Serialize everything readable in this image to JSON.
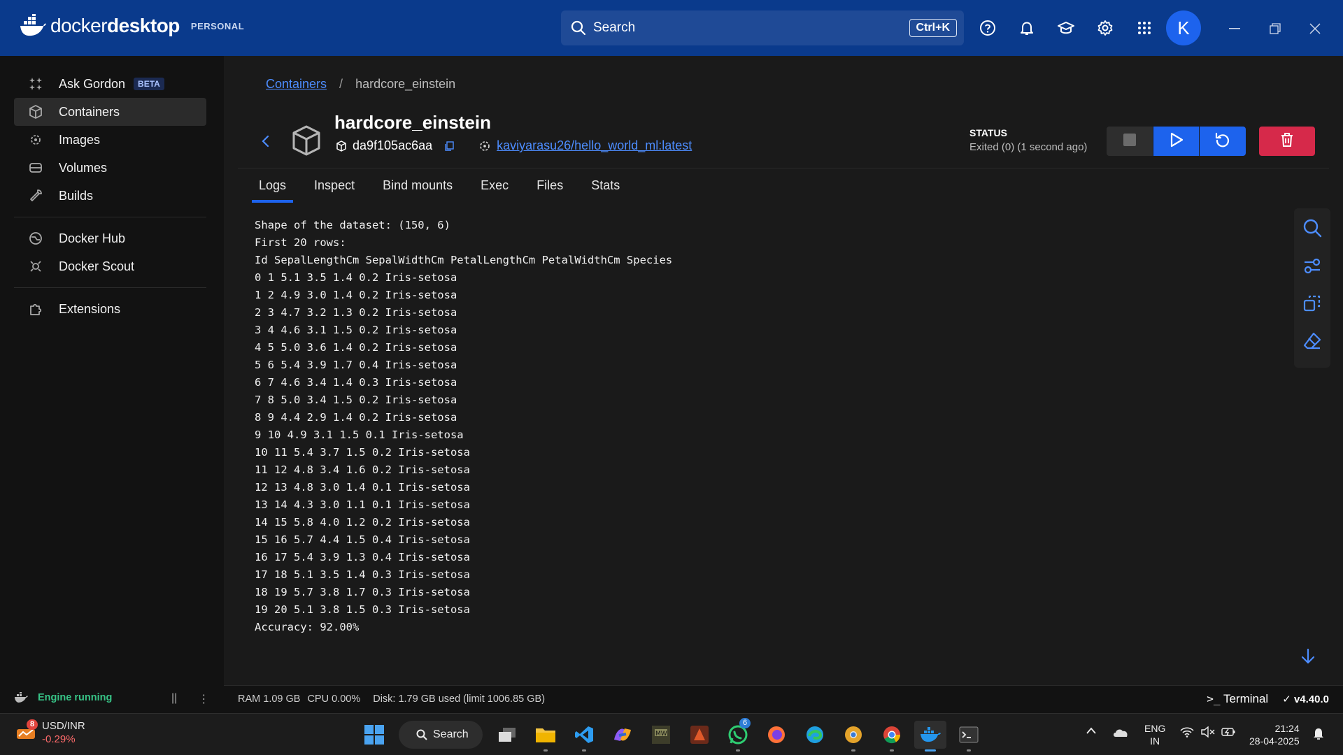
{
  "app": {
    "logo_text_light": "docker",
    "logo_text_bold": "desktop",
    "plan_badge": "PERSONAL",
    "search_placeholder": "Search",
    "search_shortcut": "Ctrl+K",
    "avatar_initial": "K",
    "accent_color": "#1d63ed",
    "topbar_color": "#0a3a8c"
  },
  "sidebar": {
    "items": [
      {
        "label": "Ask Gordon",
        "icon": "sparkle-icon",
        "badge": "BETA"
      },
      {
        "label": "Containers",
        "icon": "container-icon",
        "active": true
      },
      {
        "label": "Images",
        "icon": "image-icon"
      },
      {
        "label": "Volumes",
        "icon": "volume-icon"
      },
      {
        "label": "Builds",
        "icon": "wrench-icon"
      },
      {
        "label": "Docker Hub",
        "icon": "hub-icon"
      },
      {
        "label": "Docker Scout",
        "icon": "scout-icon"
      },
      {
        "label": "Extensions",
        "icon": "puzzle-icon"
      }
    ]
  },
  "breadcrumb": {
    "parent": "Containers",
    "separator": "/",
    "current": "hardcore_einstein"
  },
  "container": {
    "name": "hardcore_einstein",
    "id": "da9f105ac6aa",
    "image": "kaviyarasu26/hello_world_ml:latest",
    "status_label": "STATUS",
    "status_value": "Exited (0) (1 second ago)"
  },
  "tabs": [
    "Logs",
    "Inspect",
    "Bind mounts",
    "Exec",
    "Files",
    "Stats"
  ],
  "logs": [
    "Shape of the dataset: (150, 6)",
    "First 20 rows:",
    "Id SepalLengthCm SepalWidthCm PetalLengthCm PetalWidthCm Species",
    "0 1 5.1 3.5 1.4 0.2 Iris-setosa",
    "1 2 4.9 3.0 1.4 0.2 Iris-setosa",
    "2 3 4.7 3.2 1.3 0.2 Iris-setosa",
    "3 4 4.6 3.1 1.5 0.2 Iris-setosa",
    "4 5 5.0 3.6 1.4 0.2 Iris-setosa",
    "5 6 5.4 3.9 1.7 0.4 Iris-setosa",
    "6 7 4.6 3.4 1.4 0.3 Iris-setosa",
    "7 8 5.0 3.4 1.5 0.2 Iris-setosa",
    "8 9 4.4 2.9 1.4 0.2 Iris-setosa",
    "9 10 4.9 3.1 1.5 0.1 Iris-setosa",
    "10 11 5.4 3.7 1.5 0.2 Iris-setosa",
    "11 12 4.8 3.4 1.6 0.2 Iris-setosa",
    "12 13 4.8 3.0 1.4 0.1 Iris-setosa",
    "13 14 4.3 3.0 1.1 0.1 Iris-setosa",
    "14 15 5.8 4.0 1.2 0.2 Iris-setosa",
    "15 16 5.7 4.4 1.5 0.4 Iris-setosa",
    "16 17 5.4 3.9 1.3 0.4 Iris-setosa",
    "17 18 5.1 3.5 1.4 0.3 Iris-setosa",
    "18 19 5.7 3.8 1.7 0.3 Iris-setosa",
    "19 20 5.1 3.8 1.5 0.3 Iris-setosa",
    "Accuracy: 92.00%"
  ],
  "footer": {
    "engine_status": "Engine running",
    "ram": "RAM 1.09 GB",
    "cpu": "CPU 0.00%",
    "disk": "Disk: 1.79 GB used (limit 1006.85 GB)",
    "terminal_label": "Terminal",
    "version": "v4.40.0",
    "engine_color": "#37c386"
  },
  "taskbar": {
    "ticker_name": "USD/INR",
    "ticker_change": "-0.29%",
    "ticker_badge": "8",
    "search_label": "Search",
    "whatsapp_badge": "6",
    "lang_line1": "ENG",
    "lang_line2": "IN",
    "time": "21:24",
    "date": "28-04-2025"
  }
}
